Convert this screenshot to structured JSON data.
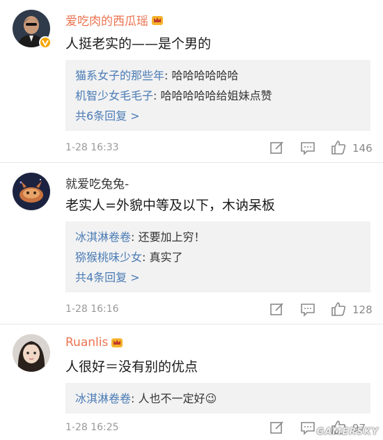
{
  "comments": [
    {
      "username": "爱吃肉的西瓜瑶",
      "text": "人挺老实的——是个男的",
      "replies": [
        {
          "name": "猫系女子的那些年",
          "text": ": 哈哈哈哈哈哈"
        },
        {
          "name": "机智少女毛毛子",
          "text": ": 哈哈哈哈哈给姐妹点赞"
        }
      ],
      "more": "共6条回复 >",
      "time": "1-28 16:33",
      "likes": "146"
    },
    {
      "username": "就爱吃兔兔-",
      "text": "老实人=外貌中等及以下，木讷呆板",
      "replies": [
        {
          "name": "冰淇淋卷卷",
          "text": ": 还要加上穷！"
        },
        {
          "name": "猕猴桃味少女",
          "text": ": 真实了"
        }
      ],
      "more": "共4条回复 >",
      "time": "1-28 16:16",
      "likes": "128"
    },
    {
      "username": "Ruanlis",
      "text": "人很好＝没有别的优点",
      "replies": [
        {
          "name": "冰淇淋卷卷",
          "text": ": 人也不一定好😉"
        }
      ],
      "time": "1-28 16:25",
      "likes": "97"
    }
  ],
  "watermark": "GAMERSKY",
  "colors": {
    "username_accent": "#eb7350",
    "reply_link": "#4a7bb5",
    "reply_bg": "#f2f2f2",
    "meta": "#999999"
  }
}
